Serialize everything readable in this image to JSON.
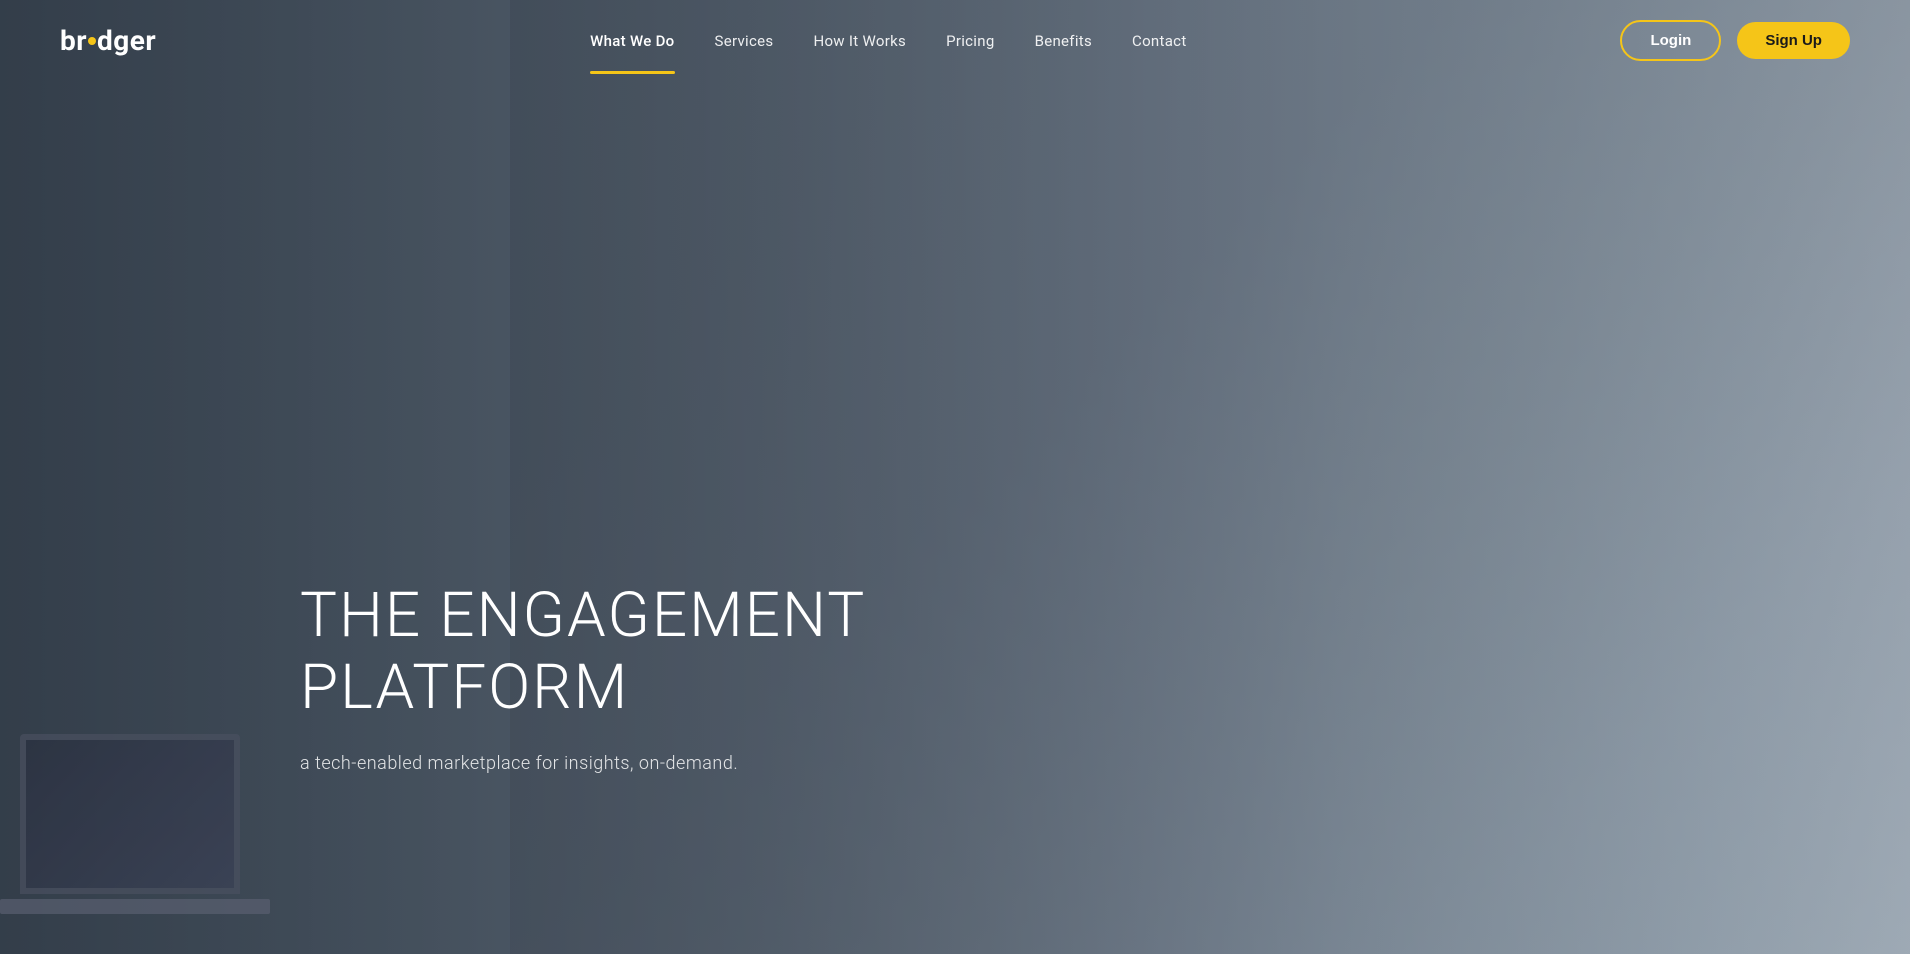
{
  "brand": {
    "logo_prefix": "br",
    "logo_dot": "·",
    "logo_suffix": "dger"
  },
  "nav": {
    "items": [
      {
        "id": "what-we-do",
        "label": "What We Do",
        "active": true
      },
      {
        "id": "services",
        "label": "Services",
        "active": false
      },
      {
        "id": "how-it-works",
        "label": "How It Works",
        "active": false
      },
      {
        "id": "pricing",
        "label": "Pricing",
        "active": false
      },
      {
        "id": "benefits",
        "label": "Benefits",
        "active": false
      },
      {
        "id": "contact",
        "label": "Contact",
        "active": false
      }
    ],
    "login_label": "Login",
    "signup_label": "Sign Up"
  },
  "hero": {
    "title_line1": "THE ENGAGEMENT",
    "title_line2": "PLATFORM",
    "subtitle": "a tech-enabled marketplace for insights, on-demand.",
    "accent_color": "#f5c518"
  }
}
